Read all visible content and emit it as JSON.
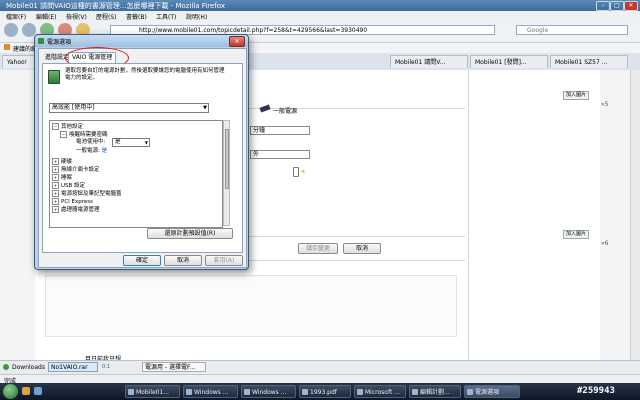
{
  "browser": {
    "title": "Mobile01 請問VAIO這種的書源管理...怎麼哪裡下載 - Mozilla Firefox",
    "window_min": "–",
    "window_max": "□",
    "window_close": "✕",
    "menu": [
      "檔案(F)",
      "編輯(E)",
      "檢視(V)",
      "歷程(S)",
      "書籤(B)",
      "工具(T)",
      "說明(H)"
    ],
    "url": "http://www.mobile01.com/topicdetail.php?f=258&t=429566&last=3930490",
    "search_placeholder": "Google",
    "bookmark": "建議的網站",
    "tabs": [
      "Yahoo!",
      "Mobile01 請問V...",
      "Mobile01 [發問]...",
      "Mobile01 SZ57 ..."
    ]
  },
  "page": {
    "power_label": "一般電源",
    "select1": "分鐘",
    "select2": "外",
    "add_pic": "加入圖片",
    "count5": "»5",
    "count6": "»6",
    "cancel_btn": "取消",
    "preview_btn": "儲存變更",
    "bottom_text": "目日前我只想"
  },
  "downloads": {
    "label": "Downloads",
    "file": "No1VAIO.rar",
    "item2": "0:1",
    "item3": "電源用 - 選擇電F..."
  },
  "status": "完成",
  "taskbar": {
    "items": [
      "Mobile01...",
      "Windows ...",
      "Windows ...",
      "1993.pdf",
      "Microsoft ...",
      "編輯計劃...",
      "電源選項"
    ],
    "watermark": "#259943"
  },
  "dialog": {
    "title": "電源選項",
    "close": "✕",
    "tabs": [
      "進階設定",
      "VAIO 電源管理"
    ],
    "description": "選取您要自訂的電源計劃，然後選取要讓您的電腦使用有如何管理電力的設定。",
    "plan": "高效能 [使用中]",
    "tree": [
      {
        "label": "其他設定",
        "indent": 0,
        "expanded": true
      },
      {
        "label": "喚醒時需要密碼",
        "indent": 1,
        "expanded": true
      },
      {
        "label": "電池使用中:",
        "indent": 2,
        "value": "是"
      },
      {
        "label": "一般電源:",
        "indent": 2,
        "value": "是"
      },
      {
        "label": "硬碟",
        "indent": 0
      },
      {
        "label": "無線介面卡設定",
        "indent": 0
      },
      {
        "label": "睡眠",
        "indent": 0
      },
      {
        "label": "USB 設定",
        "indent": 0
      },
      {
        "label": "電源按鈕及筆記型電腦蓋",
        "indent": 0
      },
      {
        "label": "PCI Express",
        "indent": 0
      },
      {
        "label": "處理器電源管理",
        "indent": 0
      }
    ],
    "restore_btn": "還原計劃預設值(R)",
    "ok": "確定",
    "cancel": "取消",
    "apply": "套用(A)"
  },
  "colors": {
    "accent_red": "#d61f1f",
    "link_blue": "#1a56b0",
    "taskbar": "#0e1624"
  }
}
